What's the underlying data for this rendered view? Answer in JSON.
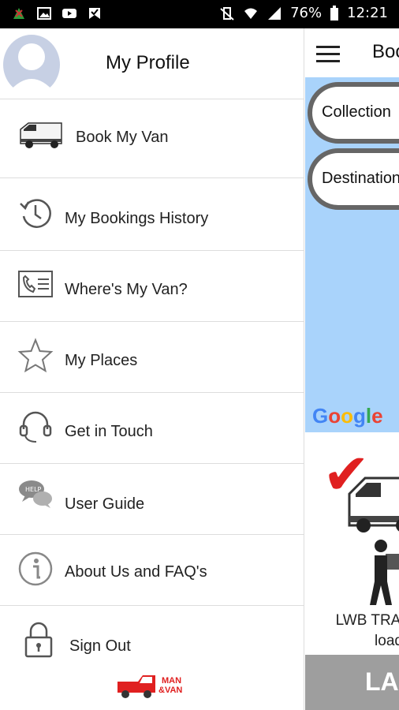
{
  "status_bar": {
    "battery": "76%",
    "time": "12:21"
  },
  "drawer": {
    "profile_title": "My Profile",
    "book_label": "Book My Van",
    "items": [
      {
        "label": "My Bookings History",
        "icon": "history-icon"
      },
      {
        "label": "Where's My Van?",
        "icon": "contact-card-icon"
      },
      {
        "label": "My Places",
        "icon": "star-icon"
      },
      {
        "label": "Get in Touch",
        "icon": "headset-icon"
      },
      {
        "label": "User Guide",
        "icon": "help-chat-icon"
      },
      {
        "label": "About Us and FAQ's",
        "icon": "info-icon"
      },
      {
        "label": "Sign Out",
        "icon": "lock-icon"
      }
    ],
    "logo_text": "MAN & VAN"
  },
  "main": {
    "title": "Boo",
    "collection_placeholder": "Collection",
    "destination_placeholder": "Destination",
    "google": "Google",
    "promo_line1": "LWB TRA",
    "promo_line2": "load",
    "bottom_band": "LA"
  },
  "colors": {
    "map": "#a9d3fb",
    "accent_red": "#e02020",
    "band_gray": "#9e9e9e"
  }
}
